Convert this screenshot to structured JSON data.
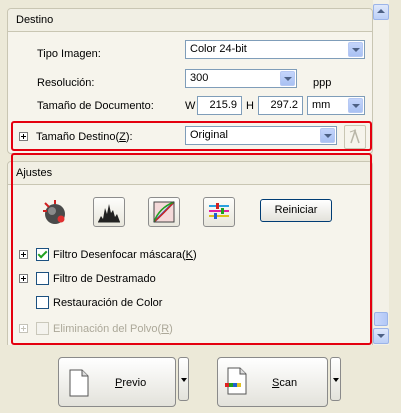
{
  "destino": {
    "title": "Destino",
    "tipo_imagen_label": "Tipo Imagen:",
    "tipo_imagen_value": "Color 24-bit",
    "resolucion_label": "Resolución:",
    "resolucion_value": "300",
    "resolucion_unit": "ppp",
    "tamano_doc_label": "Tamaño de Documento:",
    "w_label": "W",
    "w_value": "215.9",
    "h_label": "H",
    "h_value": "297.2",
    "unit_value": "mm",
    "tamano_destino_label": "Tamaño Destino(Z):",
    "tamano_destino_value": "Original"
  },
  "ajustes": {
    "title": "Ajustes",
    "reiniciar_label": "Reiniciar",
    "filtro_desenfocar_label": "Filtro Desenfocar máscara(K)",
    "filtro_desenfocar_checked": true,
    "filtro_destramado_label": "Filtro de Destramado",
    "filtro_destramado_checked": false,
    "restauracion_label": "Restauración de Color",
    "restauracion_checked": false,
    "eliminacion_label": "Eliminación del Polvo(R)",
    "eliminacion_checked": false
  },
  "actions": {
    "previo_label": "Previo",
    "scan_label": "Scan"
  },
  "icons": {
    "auto_exposure": "auto-exposure-icon",
    "histogram": "histogram-icon",
    "tone_correction": "tone-correction-icon",
    "image_adjustment": "image-adjustment-icon",
    "rotate": "rotate-icon",
    "document": "document-icon",
    "scan": "scan-icon"
  },
  "colors": {
    "highlight_red": "#e4000f",
    "panel_bg": "#ece9d8",
    "check_green": "#21a121"
  }
}
